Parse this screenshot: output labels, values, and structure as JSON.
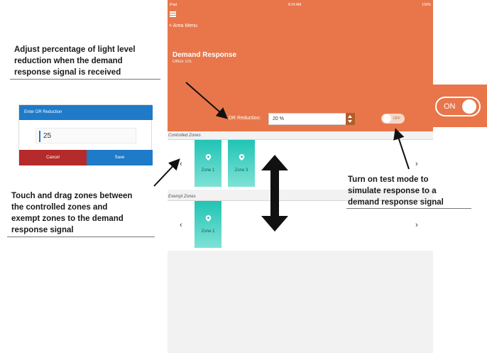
{
  "status_bar": {
    "device": "iPad",
    "time": "8:24 AM",
    "battery": "100%"
  },
  "header": {
    "back_label": "< Area Menu",
    "title": "Demand Response",
    "subtitle": "Office 101",
    "dr_label": "DR Reduction:",
    "dr_value": "20 %",
    "test_mode_toggle": "OFF"
  },
  "controlled_zones": {
    "label": "Controlled Zones",
    "zones": [
      "Zone 1",
      "Zone 3"
    ]
  },
  "exempt_zones": {
    "label": "Exempt Zones",
    "zones": [
      "Zone 2"
    ]
  },
  "popup": {
    "title": "Enter DR Reduction",
    "value": "25",
    "cancel_label": "Cancel",
    "save_label": "Save"
  },
  "on_toggle": {
    "label": "ON"
  },
  "annotations": {
    "adjust": [
      "Adjust percentage of light level",
      "reduction when the demand",
      "response signal is received"
    ],
    "drag": [
      "Touch and drag zones between",
      "the controlled zones and",
      "exempt zones to the demand",
      "response signal"
    ],
    "test": [
      "Turn on test mode to",
      "simulate response to a",
      "demand response signal"
    ]
  },
  "colors": {
    "accent": "#e8764a",
    "zone_tile": "#20c4b4",
    "popup_blue": "#1f7ac7",
    "cancel_red": "#b52a2a"
  }
}
